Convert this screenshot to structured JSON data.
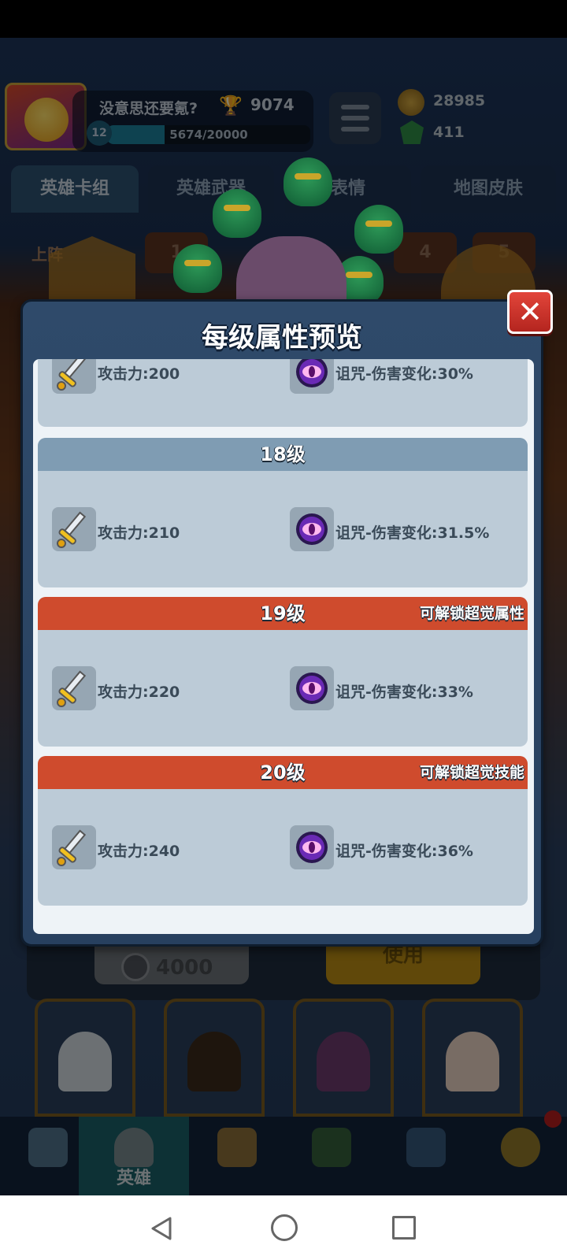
{
  "hud": {
    "player_name": "没意思还要氪?",
    "trophies": "9074",
    "level": "12",
    "xp_text": "5674/20000",
    "xp_progress": 0.2837,
    "gold": "28985",
    "gems": "411"
  },
  "tabs": [
    {
      "label": "英雄卡组",
      "active": true
    },
    {
      "label": "英雄武器",
      "active": false
    },
    {
      "label": "表情",
      "active": false
    },
    {
      "label": "地图皮肤",
      "active": false
    }
  ],
  "background_row": {
    "label": "上阵",
    "slots": [
      "1",
      "4",
      "5"
    ]
  },
  "purchase": {
    "price": "4000",
    "use_label": "使用"
  },
  "modal": {
    "title": "每级属性预览",
    "close_label": "✕",
    "levels": [
      {
        "title": "",
        "note": "",
        "attack_label": "攻击力:",
        "attack": "200",
        "curse_label": "诅咒-伤害变化:",
        "curse": "30%"
      },
      {
        "title": "18级",
        "note": "",
        "attack_label": "攻击力:",
        "attack": "210",
        "curse_label": "诅咒-伤害变化:",
        "curse": "31.5%"
      },
      {
        "title": "19级",
        "note": "可解锁超觉属性",
        "attack_label": "攻击力:",
        "attack": "220",
        "curse_label": "诅咒-伤害变化:",
        "curse": "33%"
      },
      {
        "title": "20级",
        "note": "可解锁超觉技能",
        "attack_label": "攻击力:",
        "attack": "240",
        "curse_label": "诅咒-伤害变化:",
        "curse": "36%"
      }
    ]
  },
  "bottom_nav": [
    {
      "label": "",
      "icon": "chest-icon"
    },
    {
      "label": "英雄",
      "icon": "helmet-icon",
      "active": true
    },
    {
      "label": "",
      "icon": "crossed-swords-icon"
    },
    {
      "label": "",
      "icon": "crown-shield-icon"
    },
    {
      "label": "",
      "icon": "team-banner-icon"
    },
    {
      "label": "",
      "icon": "compass-icon"
    }
  ],
  "colors": {
    "unlock_header": "#cf4b2d",
    "normal_header": "#7f9cb3",
    "card_bg": "#bccbd7",
    "modal_bg": "#2f4a6a",
    "close_button": "#e2453a"
  }
}
